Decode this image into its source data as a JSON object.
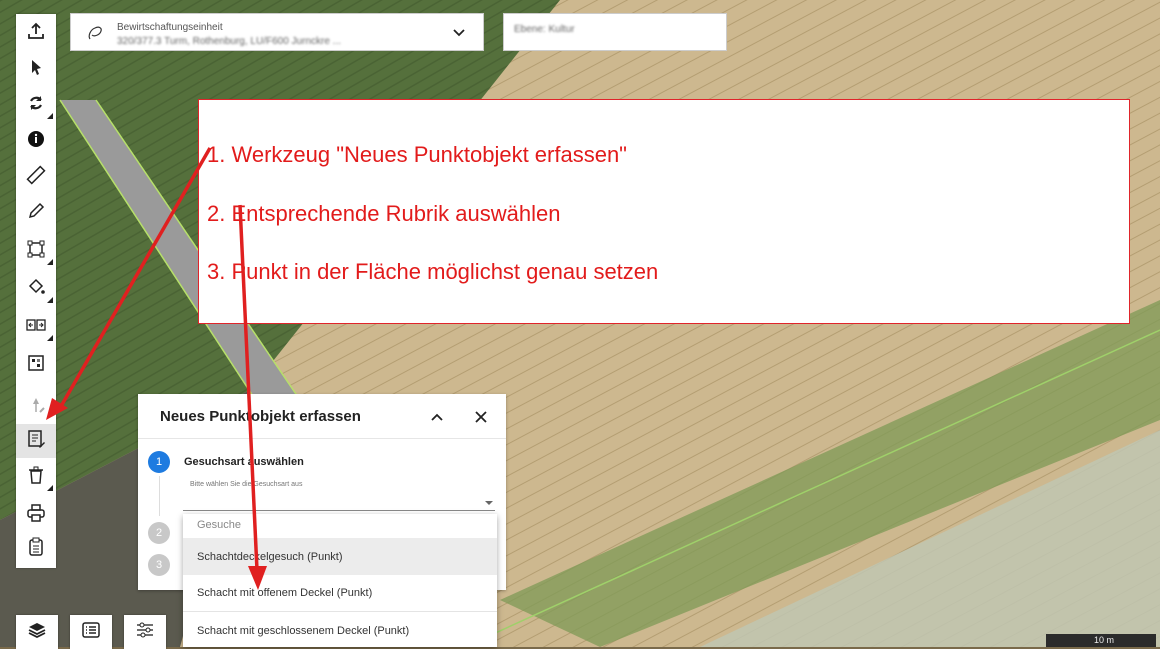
{
  "colors": {
    "accent_blue": "#1e7be0",
    "annotation_red": "#e21b1b",
    "field_green": "#6f8248",
    "field_tan": "#c9b48a"
  },
  "toolbar": {
    "tools": [
      {
        "icon": "upload-icon"
      },
      {
        "icon": "pointer-icon"
      },
      {
        "icon": "refresh-icon"
      },
      {
        "icon": "info-icon"
      },
      {
        "icon": "ruler-icon"
      },
      {
        "icon": "pencil-icon"
      },
      {
        "icon": "polygon-edit-icon"
      },
      {
        "icon": "fill-bucket-icon"
      },
      {
        "icon": "split-icon"
      },
      {
        "icon": "grid-select-icon"
      },
      {
        "icon": "point-create-icon"
      },
      {
        "icon": "new-point-object-icon"
      },
      {
        "icon": "trash-icon"
      },
      {
        "icon": "print-icon"
      },
      {
        "icon": "clipboard-icon"
      }
    ]
  },
  "header": {
    "bewirtschaftungseinheit_label": "Bewirtschaftungseinheit",
    "bewirtschaftungseinheit_value": "320/377.3 Turm, Rothenburg, LU/F600 Jurnckre ...",
    "ebene_value": "Ebene: Kultur"
  },
  "annotation": {
    "line1": "1. Werkzeug \"Neues Punktobjekt erfassen\"",
    "line2": "2. Entsprechende Rubrik auswählen",
    "line3": "3. Punkt in der Fläche möglichst genau setzen"
  },
  "panel": {
    "title": "Neues Punktobjekt erfassen",
    "step1_number": "1",
    "step1_title": "Gesuchsart auswählen",
    "step1_hint": "Bitte wählen Sie die Gesuchsart aus",
    "step2_number": "2",
    "step3_number": "3"
  },
  "dropdown": {
    "group_label": "Gesuche",
    "items": [
      "Schachtdeckelgesuch (Punkt)",
      "Schacht mit offenem Deckel (Punkt)",
      "Schacht mit geschlossenem Deckel (Punkt)"
    ]
  },
  "bottom_bar": {
    "buttons": [
      {
        "icon": "layers-icon"
      },
      {
        "icon": "list-icon"
      },
      {
        "icon": "sliders-icon"
      }
    ]
  },
  "scale": {
    "label": "10 m"
  }
}
